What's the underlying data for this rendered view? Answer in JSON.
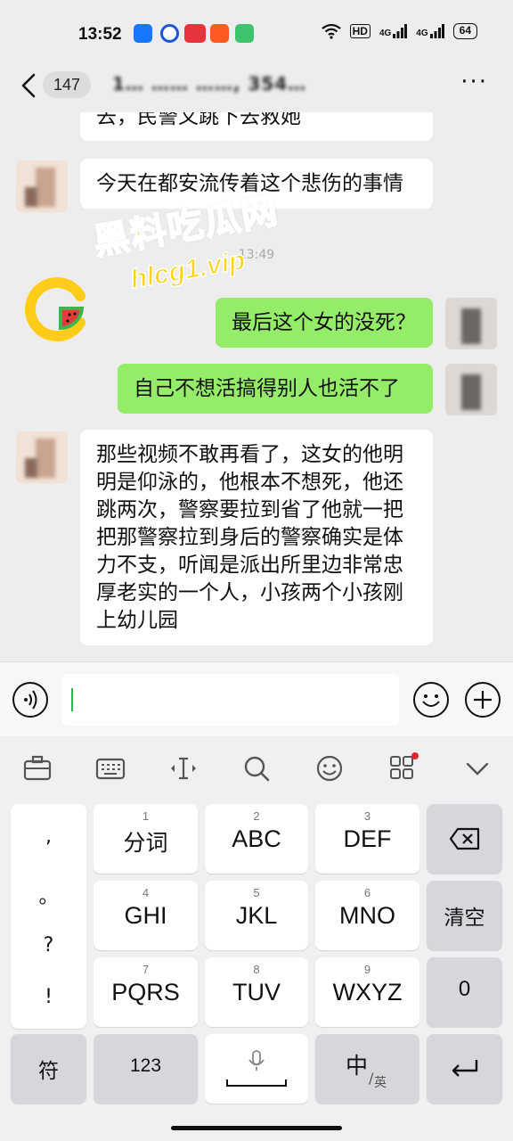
{
  "status_bar": {
    "time": "13:52",
    "hd_label": "HD",
    "signal_label_1": "4G",
    "signal_label_2": "4G",
    "battery": "64"
  },
  "header": {
    "unread_count": "147",
    "title": "1… …… ……, 354…",
    "more_icon": "more-dots-icon"
  },
  "messages": [
    {
      "side": "in",
      "text": "去，民警又跳下去救她"
    },
    {
      "side": "in",
      "text": "今天在都安流传着这个悲伤的事情"
    },
    {
      "side": "out",
      "text": "最后这个女的没死？"
    },
    {
      "side": "out",
      "text": "自己不想活搞得别人也活不了"
    },
    {
      "side": "in",
      "lines": [
        "那些视频不敢再看了，这女的他明",
        "明是仰泳的，他根本不想死，他还",
        "跳两次，警察要拉到省了他就一把",
        "把那警察拉到身后的警察确实是体",
        "力不支，听闻是派出所里边非常忠",
        "厚老实的一个人，小孩两个小孩刚",
        "上幼儿园"
      ]
    }
  ],
  "timestamp": "13:49",
  "watermark": {
    "text_cn": "黑料吃瓜网",
    "text_url": "hlcg1.vip"
  },
  "input": {
    "value": ""
  },
  "keyboard": {
    "tools": [
      "briefcase-icon",
      "keyboard-icon",
      "cursor-move-icon",
      "search-icon",
      "emoji-icon",
      "grid-apps-icon",
      "chevron-down-icon"
    ],
    "punct": [
      ",",
      "。",
      "?",
      "!"
    ],
    "keys": [
      {
        "num": "1",
        "label": "分词"
      },
      {
        "num": "2",
        "label": "ABC"
      },
      {
        "num": "3",
        "label": "DEF"
      },
      {
        "num": "4",
        "label": "GHI"
      },
      {
        "num": "5",
        "label": "JKL"
      },
      {
        "num": "6",
        "label": "MNO"
      },
      {
        "num": "7",
        "label": "PQRS"
      },
      {
        "num": "8",
        "label": "TUV"
      },
      {
        "num": "9",
        "label": "WXYZ"
      }
    ],
    "clear_label": "清空",
    "zero_label": "0",
    "symbol_label": "符",
    "numeric_label": "123",
    "lang_main": "中",
    "lang_sub": "英",
    "accent": "#95ec69"
  }
}
